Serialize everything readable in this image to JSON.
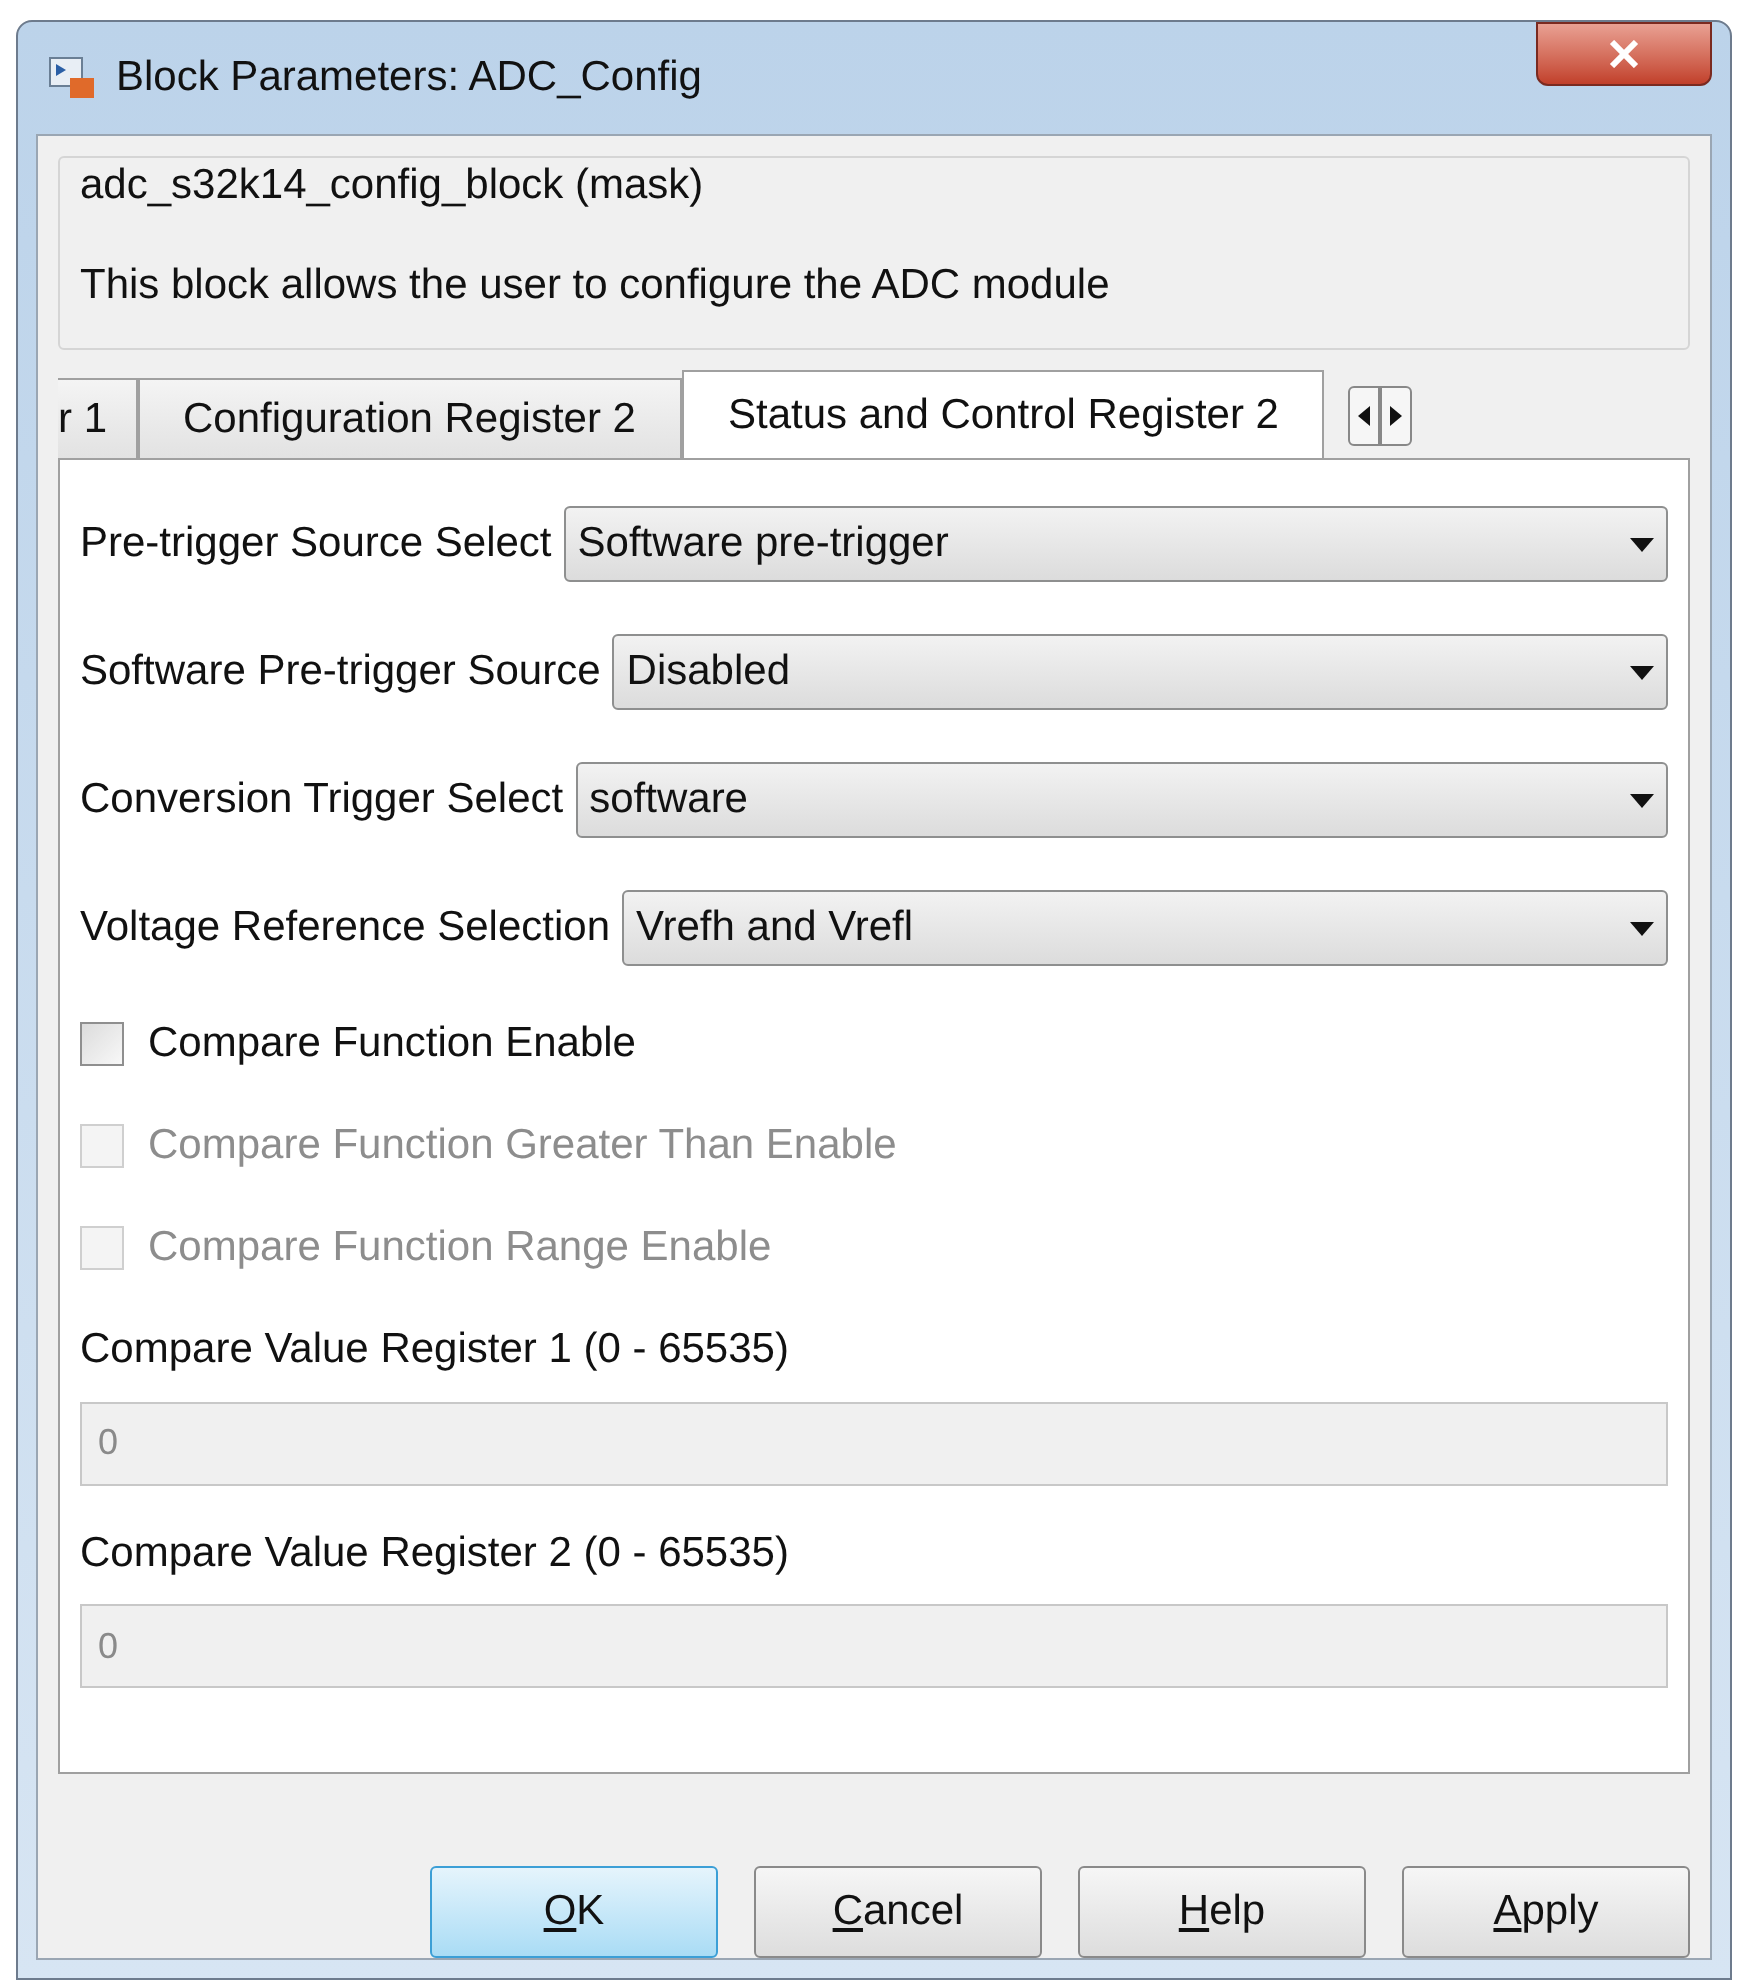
{
  "window": {
    "title": "Block Parameters: ADC_Config"
  },
  "mask": {
    "title": "adc_s32k14_config_block (mask)",
    "description": "This block allows the user to configure the ADC module"
  },
  "tabs": [
    {
      "label": "r 1",
      "selected": false
    },
    {
      "label": "Configuration Register 2",
      "selected": false
    },
    {
      "label": "Status and Control Register 2",
      "selected": true
    }
  ],
  "params": [
    {
      "kind": "dropdown",
      "label": "Pre-trigger Source Select",
      "value": "Software pre-trigger"
    },
    {
      "kind": "dropdown",
      "label": "Software Pre-trigger Source",
      "value": "Disabled"
    },
    {
      "kind": "dropdown",
      "label": "Conversion Trigger Select",
      "value": "software"
    },
    {
      "kind": "dropdown",
      "label": "Voltage Reference Selection",
      "value": "Vrefh and Vrefl"
    },
    {
      "kind": "checkbox",
      "label": "Compare Function Enable",
      "checked": false,
      "disabled": false
    },
    {
      "kind": "checkbox",
      "label": "Compare Function Greater Than Enable",
      "checked": false,
      "disabled": true
    },
    {
      "kind": "checkbox",
      "label": "Compare Function Range Enable",
      "checked": false,
      "disabled": true
    },
    {
      "kind": "edit",
      "label": "Compare Value Register 1 (0 - 65535)",
      "value": "0",
      "disabled": true
    },
    {
      "kind": "edit",
      "label": "Compare Value Register 2 (0 - 65535)",
      "value": "0",
      "disabled": true
    }
  ],
  "buttons": [
    {
      "mnemonic": "O",
      "rest": "K",
      "default": true
    },
    {
      "mnemonic": "C",
      "rest": "ancel",
      "default": false
    },
    {
      "mnemonic": "H",
      "rest": "elp",
      "default": false
    },
    {
      "mnemonic": "A",
      "rest": "pply",
      "default": false
    }
  ]
}
